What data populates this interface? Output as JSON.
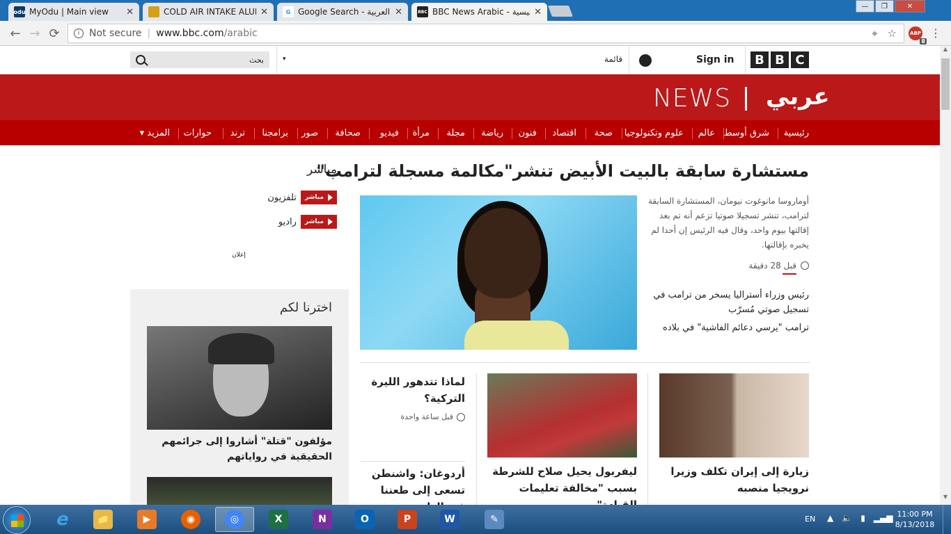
{
  "browser": {
    "tabs": [
      {
        "title": "MyOdu | Main view",
        "icon_text": "odu",
        "icon_color": "#0d3a6b"
      },
      {
        "title": "COLD AIR INTAKE ALUMI",
        "icon_text": "",
        "icon_color": "#d4a017"
      },
      {
        "title": "Google Search - العربية",
        "icon_text": "G",
        "icon_color": "#4285f4"
      },
      {
        "title": "BBC News Arabic - الرئيسية",
        "icon_text": "BBC",
        "icon_color": "#222222"
      }
    ],
    "close_glyph": "✕",
    "window_controls": {
      "minimize": "—",
      "maximize": "❐",
      "close": "✕"
    },
    "back": "←",
    "forward": "→",
    "reload": "⟳",
    "security_label": "Not secure",
    "url_domain": "www.bbc.com",
    "url_path": "/arabic",
    "extension_label": "ABP",
    "extension_badge": "8",
    "menu": "⋮"
  },
  "bbc_header": {
    "logo_letters": [
      "B",
      "B",
      "C"
    ],
    "sign_in": "Sign in",
    "menu_label": "قائمة",
    "search_placeholder": "بحث",
    "dropdown": "▾"
  },
  "news_banner": {
    "news_word": "NEWS",
    "arabic_word": "عربي"
  },
  "nav": {
    "items": [
      "رئيسية",
      "شرق أوسط",
      "عالم",
      "علوم وتكنولوجيا",
      "صحة",
      "اقتصاد",
      "فنون",
      "رياضة",
      "مجلة",
      "مرأة",
      "فيديو",
      "صحافة",
      "صور",
      "برامجنا",
      "ترند",
      "حوارات"
    ],
    "more": "المزيد ▾"
  },
  "main_story": {
    "headline": "مستشارة سابقة بالبيت الأبيض تنشر\"مكالمة مسجلة لترامب\"",
    "summary": "أوماروسا مانوغوت نيومان، المستشارة السابقة لترامب، تنشر تسجيلا صوتيا تزعم أنه تم بعد إقالتها بيوم واحد، وقال فيه الرئيس إن أحدا لم يخبره بإقالتها.",
    "timestamp": "قبل 28 دقيقة",
    "related": [
      "رئيس وزراء أستراليا يسخر من ترامب في تسجيل صوتي مُسرّب",
      "ترامب \"يرسي دعائم الفاشية\" في بلاده"
    ]
  },
  "secondary_stories": [
    {
      "title": "زيارة إلى إيران تكلف وزيرا نرويجيا منصبه"
    },
    {
      "title": "ليفربول يحيل صلاح للشرطة بسبب \"مخالفة تعليمات القيادة\""
    },
    {
      "title": "لماذا تتدهور الليرة التركية؟",
      "timestamp": "قبل ساعة واحدة"
    },
    {
      "title": "أردوغان: واشنطن تسعى إلى طعننا في الظهر"
    }
  ],
  "live": {
    "heading": "مباشر",
    "badge": "مباشر",
    "items": [
      "تلفزيون",
      "راديو"
    ]
  },
  "ad_label": "إعلان",
  "picks": {
    "heading": "اخترنا لكم",
    "story": "مؤلفون \"قتلة\" أشاروا إلى جرائمهم الحقيقية في رواياتهم"
  },
  "taskbar": {
    "apps": [
      {
        "name": "file-explorer",
        "label": "📁",
        "color": "#e8b84a"
      },
      {
        "name": "media-player",
        "label": "▶",
        "color": "#e87a2a"
      },
      {
        "name": "firefox",
        "label": "◉",
        "color": "#e66000"
      },
      {
        "name": "chrome",
        "label": "◎",
        "color": "#4285f4"
      },
      {
        "name": "excel",
        "label": "X",
        "color": "#1d7044"
      },
      {
        "name": "onenote",
        "label": "N",
        "color": "#7b2f9e"
      },
      {
        "name": "outlook",
        "label": "O",
        "color": "#0a64b6"
      },
      {
        "name": "powerpoint",
        "label": "P",
        "color": "#c9431e"
      },
      {
        "name": "word",
        "label": "W",
        "color": "#1f57a6"
      },
      {
        "name": "paint",
        "label": "✎",
        "color": "#5a8ac0"
      }
    ],
    "language": "EN",
    "time": "11:00 PM",
    "date": "8/13/2018",
    "ie_label": "e"
  },
  "colors": {
    "bbc_red": "#bb1919",
    "nav_red": "#b80000"
  }
}
